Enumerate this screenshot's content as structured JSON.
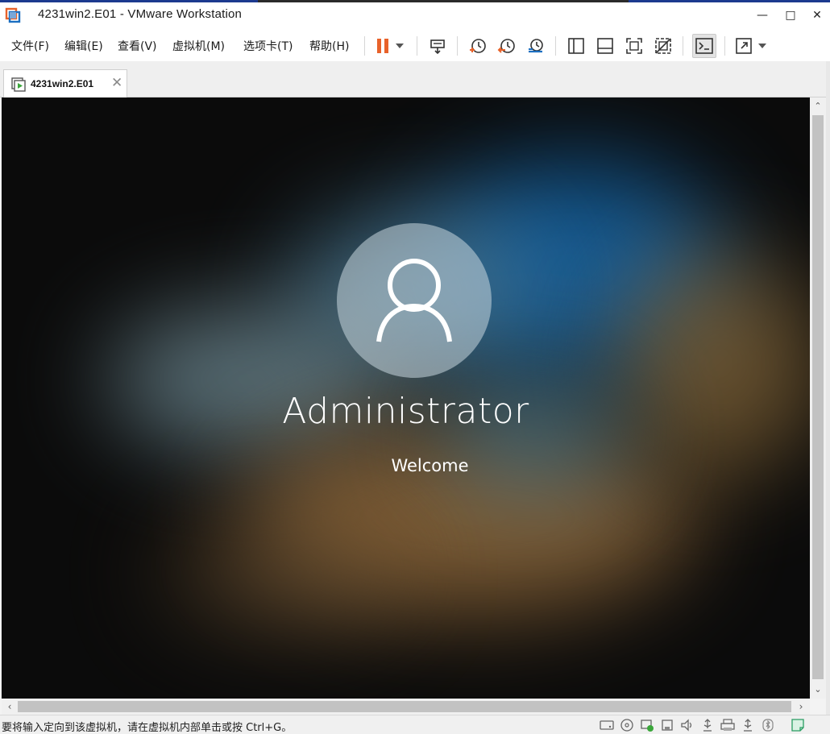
{
  "window": {
    "title": "4231win2.E01 - VMware Workstation",
    "minimize_glyph": "—",
    "maximize_glyph": "□",
    "close_glyph": "✕"
  },
  "menu": [
    {
      "label": "文件(F)"
    },
    {
      "label": "编辑(E)"
    },
    {
      "label": "查看(V)"
    },
    {
      "label": "虚拟机(M)"
    },
    {
      "label": "选项卡(T)"
    },
    {
      "label": "帮助(H)"
    }
  ],
  "toolbar_icons": [
    "pause-icon",
    "pause-dropdown-icon",
    "send-ctrl-alt-del-icon",
    "take-snapshot-icon",
    "revert-snapshot-icon",
    "snapshot-manager-icon",
    "show-library-icon",
    "thumbnail-bar-icon",
    "full-screen-icon",
    "unity-icon",
    "console-view-icon",
    "stretch-guest-icon",
    "stretch-dropdown-icon"
  ],
  "tab": {
    "label": "4231win2.E01",
    "close_glyph": "✕"
  },
  "vm": {
    "username": "Administrator",
    "status": "Welcome"
  },
  "scroll": {
    "up": "⌃",
    "down": "⌄",
    "left": "‹",
    "right": "›"
  },
  "statusbar": {
    "message": "要将输入定向到该虚拟机，请在虚拟机内部单击或按 Ctrl+G。",
    "device_icons": [
      "hard-disk-icon",
      "cd-dvd-icon",
      "network-adapter-icon",
      "usb-controller-icon",
      "sound-card-icon",
      "usb-device-icon",
      "printer-icon",
      "usb-device-2-icon",
      "bluetooth-icon",
      "notes-icon"
    ]
  },
  "colors": {
    "accent_orange": "#e8622a",
    "accent_blue": "#1c6fc1",
    "brand_blue": "#1c3a8f"
  }
}
